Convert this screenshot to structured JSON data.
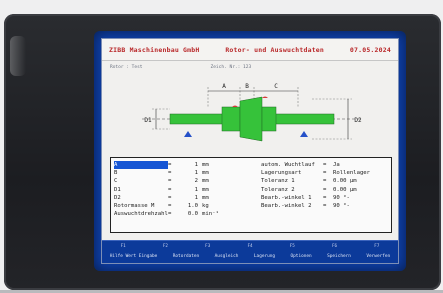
{
  "header": {
    "left": "ZIBB Maschinenbau GmbH",
    "center": "Rotor- und Auswuchtdaten",
    "date": "07.05.2024"
  },
  "subheader": {
    "left": "Rotor : Test",
    "right": "Zeich. Nr.: 123"
  },
  "diagram": {
    "dim_a": "A",
    "dim_b": "B",
    "dim_c": "C",
    "dim_d1": "D1",
    "dim_d2": "D2"
  },
  "params_left": [
    {
      "label": "A",
      "eq": "=",
      "value": "1",
      "unit": "mm"
    },
    {
      "label": "B",
      "eq": "=",
      "value": "1",
      "unit": "mm"
    },
    {
      "label": "C",
      "eq": "=",
      "value": "2",
      "unit": "mm"
    },
    {
      "label": "D1",
      "eq": "=",
      "value": "1",
      "unit": "mm"
    },
    {
      "label": "D2",
      "eq": "=",
      "value": "1",
      "unit": "mm"
    },
    {
      "label": "Rotormasse M",
      "eq": "=",
      "value": "1.0",
      "unit": "kg"
    },
    {
      "label": "Auswuchtdrehzahl",
      "eq": "=",
      "value": "0.0",
      "unit": "min⁻¹"
    }
  ],
  "params_right": [
    {
      "label": "autom. Wuchtlauf",
      "eq": "=",
      "value": "Ja"
    },
    {
      "label": "Lagerungsart",
      "eq": "=",
      "value": "Rollenlager"
    },
    {
      "label": "Toleranz 1",
      "eq": "=",
      "value": "0.00  µm"
    },
    {
      "label": "Toleranz 2",
      "eq": "=",
      "value": "0.00  µm"
    },
    {
      "label": "Bearb.-winkel 1",
      "eq": "=",
      "value": "90 °-"
    },
    {
      "label": "Bearb.-winkel 2",
      "eq": "=",
      "value": "90 °-"
    }
  ],
  "fkeys": {
    "numbers": [
      "F1",
      "F2",
      "F3",
      "F4",
      "F5",
      "F6",
      "F7"
    ],
    "labels": [
      "Hilfe Wert Eingabe",
      "Rotordaten",
      "Ausgleich",
      "Lagerung",
      "Optionen",
      "Speichern",
      "Verwerfen"
    ]
  },
  "colors": {
    "screen_bg": "#0e3fa8",
    "header_text": "#b9282a",
    "rotor_green": "#36c23a",
    "selection": "#1555d4"
  }
}
